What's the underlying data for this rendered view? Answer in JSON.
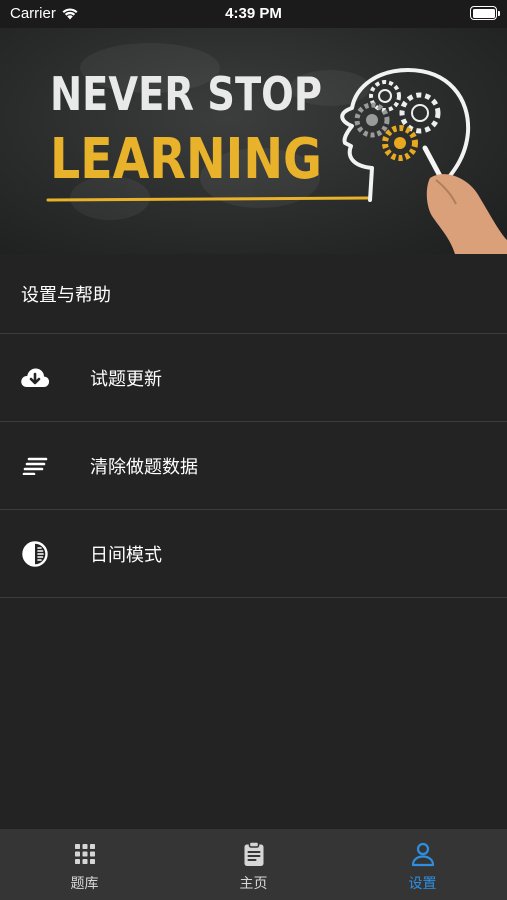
{
  "status_bar": {
    "carrier": "Carrier",
    "time": "4:39 PM"
  },
  "banner": {
    "line1": "NEVER STOP",
    "line2": "LEARNING"
  },
  "section": {
    "title": "设置与帮助"
  },
  "menu": {
    "items": [
      {
        "label": "试题更新",
        "icon": "cloud-download-icon"
      },
      {
        "label": "清除做题数据",
        "icon": "clear-lines-icon"
      },
      {
        "label": "日间模式",
        "icon": "contrast-icon"
      }
    ]
  },
  "tab_bar": {
    "tabs": [
      {
        "label": "题库",
        "icon": "grid-icon",
        "active": false
      },
      {
        "label": "主页",
        "icon": "clipboard-icon",
        "active": false
      },
      {
        "label": "设置",
        "icon": "person-icon",
        "active": true
      }
    ]
  },
  "colors": {
    "background": "#232323",
    "tab_bar": "#353535",
    "accent": "#2d8fe4",
    "banner_yellow": "#e8b22a"
  }
}
